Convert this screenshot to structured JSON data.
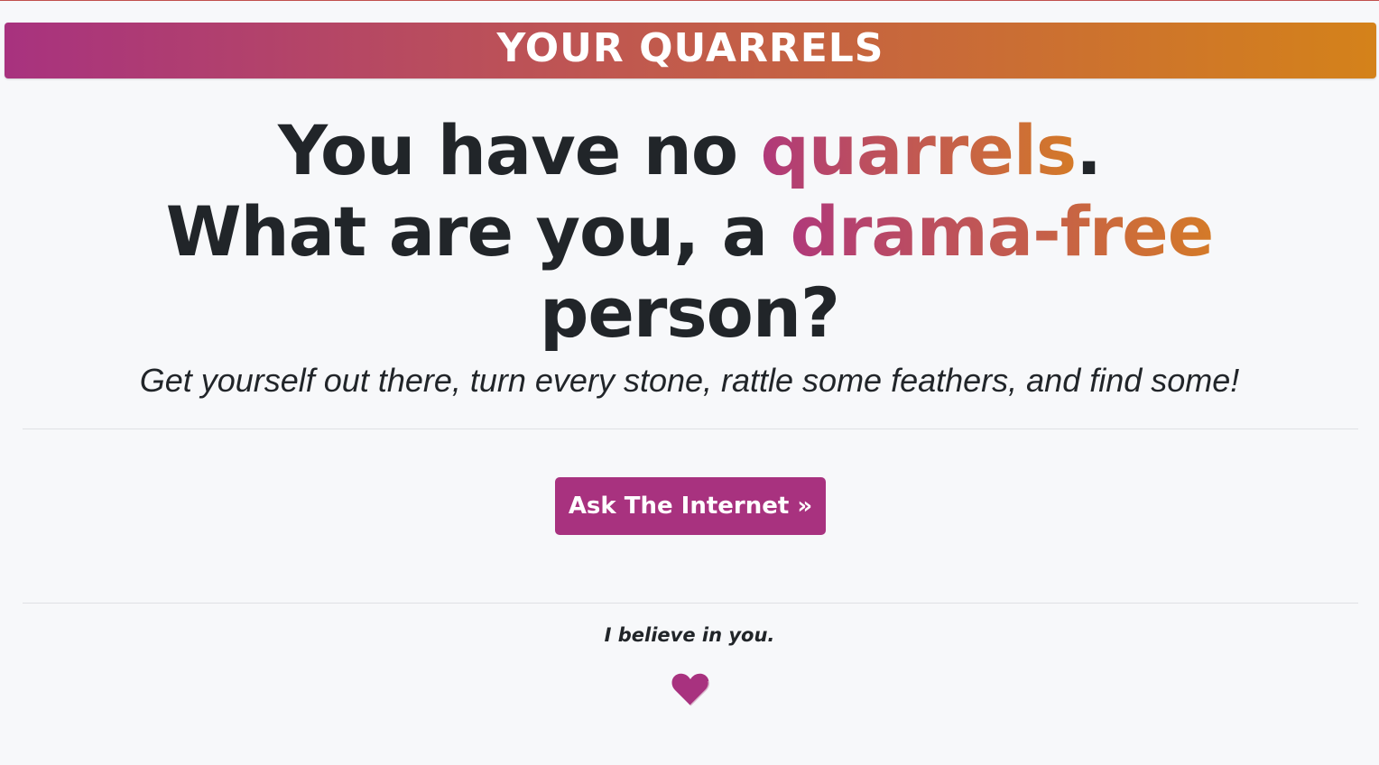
{
  "header": {
    "title": "YOUR QUARRELS"
  },
  "headline": {
    "part1": "You have no ",
    "highlight1": "quarrels",
    "part2": ".",
    "part3": "What are you, a ",
    "highlight2": "drama-free",
    "part4": "person?"
  },
  "subtitle": "Get yourself out there, turn every stone, rattle some feathers, and find some!",
  "cta": {
    "label": "Ask The Internet »"
  },
  "footer": {
    "message": "I believe in you.",
    "icon": "heart-icon"
  },
  "colors": {
    "brand_purple": "#a8327f",
    "brand_orange": "#d4821a",
    "background": "#f7f8fa",
    "text": "#212529"
  }
}
